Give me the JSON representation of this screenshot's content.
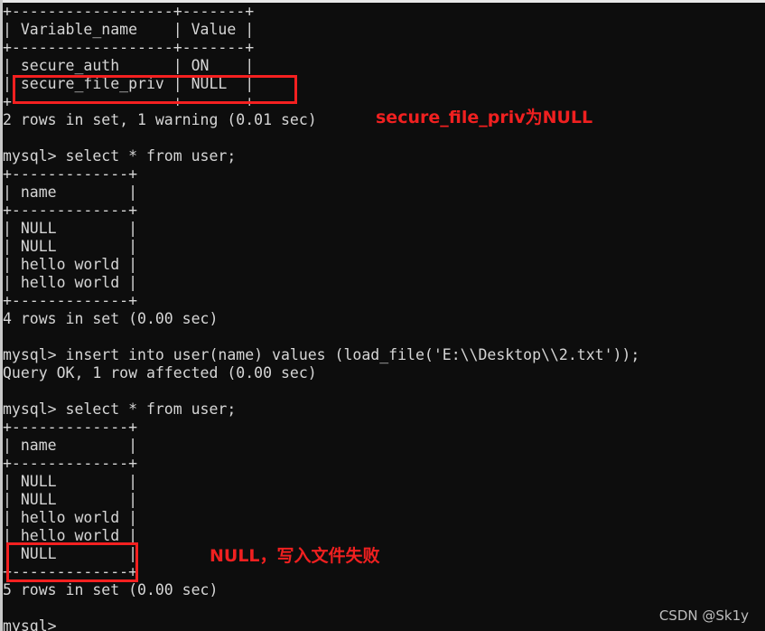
{
  "terminal": {
    "prompt": "mysql>",
    "background_color": "#0d0d0d",
    "text_color": "#d6d6d6",
    "lines": [
      "+------------------+-------+",
      "| Variable_name    | Value |",
      "+------------------+-------+",
      "| secure_auth      | ON    |",
      "| secure_file_priv | NULL  |",
      "+------------------+-------+",
      "2 rows in set, 1 warning (0.01 sec)",
      "",
      "mysql> select * from user;",
      "+-------------+",
      "| name        |",
      "+-------------+",
      "| NULL        |",
      "| NULL        |",
      "| hello world |",
      "| hello world |",
      "+-------------+",
      "4 rows in set (0.00 sec)",
      "",
      "mysql> insert into user(name) values (load_file('E:\\\\Desktop\\\\2.txt'));",
      "Query OK, 1 row affected (0.00 sec)",
      "",
      "mysql> select * from user;",
      "+-------------+",
      "| name        |",
      "+-------------+",
      "| NULL        |",
      "| NULL        |",
      "| hello world |",
      "| hello world |",
      "| NULL        |",
      "+-------------+",
      "5 rows in set (0.00 sec)",
      "",
      "mysql>"
    ]
  },
  "annotations": {
    "color": "#f02020",
    "box_color": "#f42020",
    "items": [
      {
        "id": "secure-file-priv-null",
        "text": "secure_file_priv为NULL"
      },
      {
        "id": "write-file-failed",
        "text": "NULL，写入文件失败"
      }
    ]
  },
  "watermark": {
    "text": "CSDN @Sk1y"
  }
}
